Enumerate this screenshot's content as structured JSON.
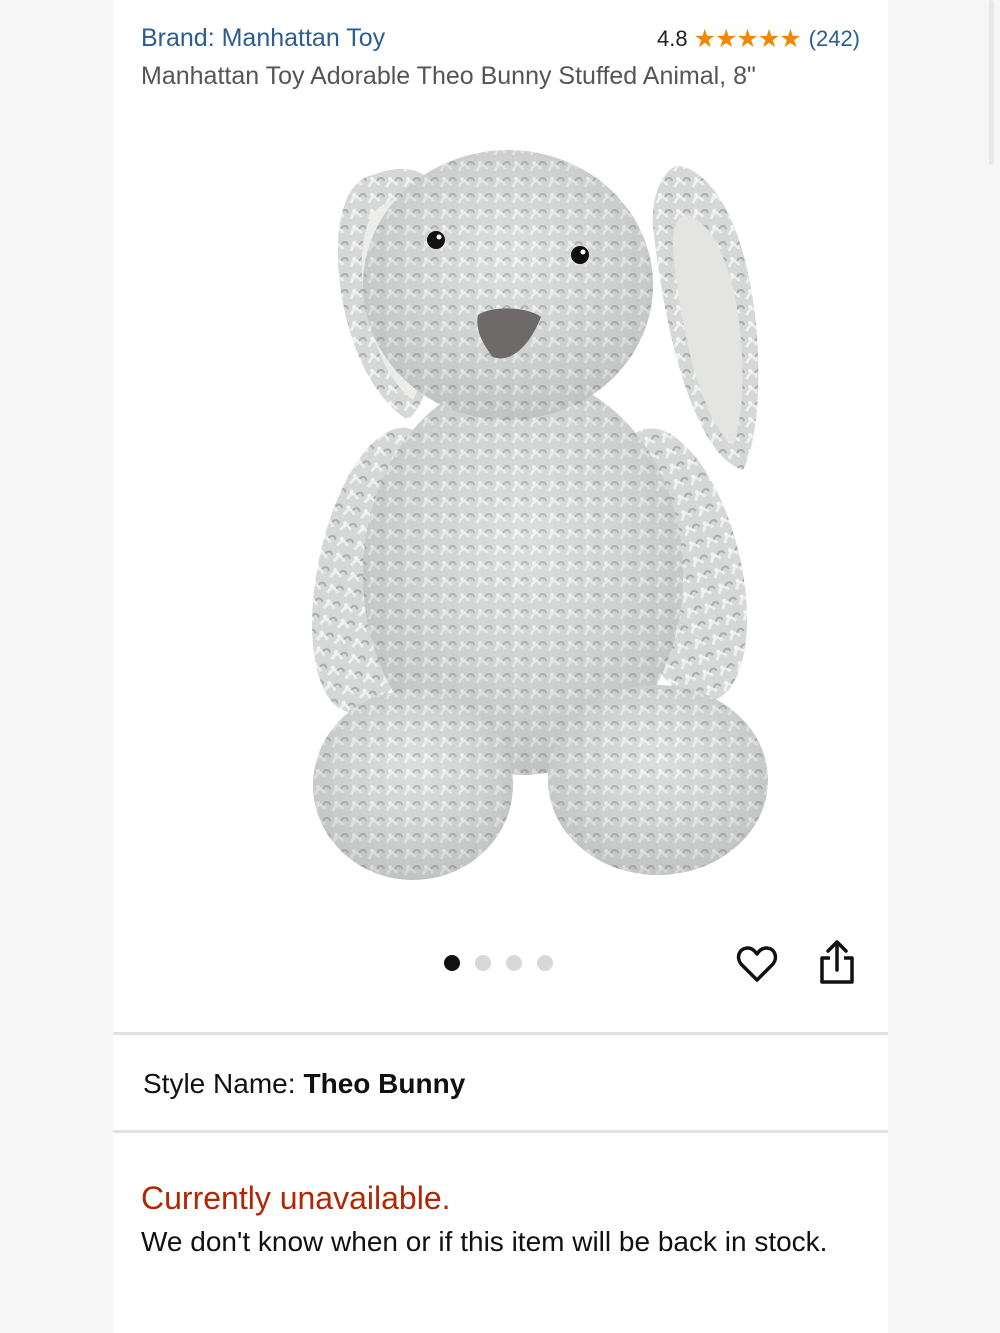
{
  "header": {
    "brand": "Brand: Manhattan Toy",
    "rating_value": "4.8",
    "stars": 4.8,
    "stars_text": "★★★★★",
    "review_count": "(242)",
    "colors": {
      "link": "#2b5d8e",
      "star": "#f08804"
    }
  },
  "product": {
    "title": "Manhattan Toy Adorable Theo Bunny Stuffed Animal, 8\"",
    "image_alt": "gray plush bunny with white floppy ears",
    "carousel": {
      "total": 4,
      "active": 1
    }
  },
  "actions": {
    "wishlist_icon": "heart-icon",
    "share_icon": "share-icon"
  },
  "style": {
    "label": "Style Name:",
    "value": "Theo Bunny"
  },
  "availability": {
    "status": "Currently unavailable.",
    "message": "We don't know when or if this item will be back in stock.",
    "status_color": "#b12704"
  }
}
